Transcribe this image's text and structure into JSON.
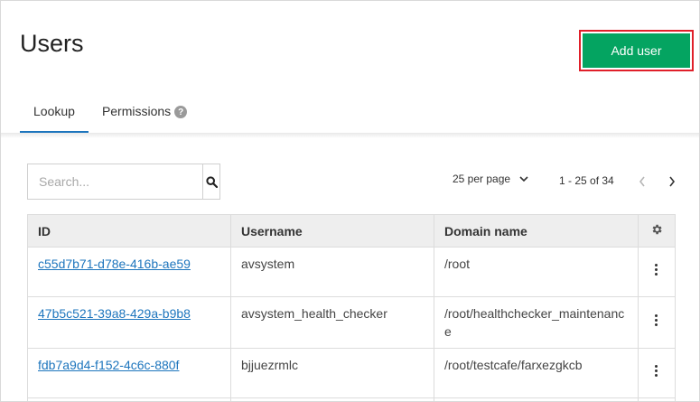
{
  "page": {
    "title": "Users"
  },
  "header": {
    "add_user_label": "Add user"
  },
  "tabs": [
    {
      "label": "Lookup",
      "active": true
    },
    {
      "label": "Permissions",
      "has_help_icon": true
    }
  ],
  "search": {
    "placeholder": "Search...",
    "value": ""
  },
  "pagination": {
    "per_page": "25 per page",
    "range": "1 - 25 of 34"
  },
  "table": {
    "columns": [
      "ID",
      "Username",
      "Domain name"
    ],
    "rows": [
      {
        "id": "c55d7b71-d78e-416b-ae59",
        "username": "avsystem",
        "domain": "/root"
      },
      {
        "id": "47b5c521-39a8-429a-b9b8",
        "username": "avsystem_health_checker",
        "domain": "/root/healthchecker_maintenance"
      },
      {
        "id": "fdb7a9d4-f152-4c6c-880f",
        "username": "bjjuezrmlc",
        "domain": "/root/testcafe/farxezgkcb"
      }
    ]
  },
  "colors": {
    "accent": "#04a461",
    "link": "#1d75bd",
    "highlight_border": "#e0202a"
  },
  "icons": [
    "search-icon",
    "chevron-down-icon",
    "chevron-left-icon",
    "chevron-right-icon",
    "gear-icon",
    "kebab-menu-icon",
    "help-icon"
  ]
}
